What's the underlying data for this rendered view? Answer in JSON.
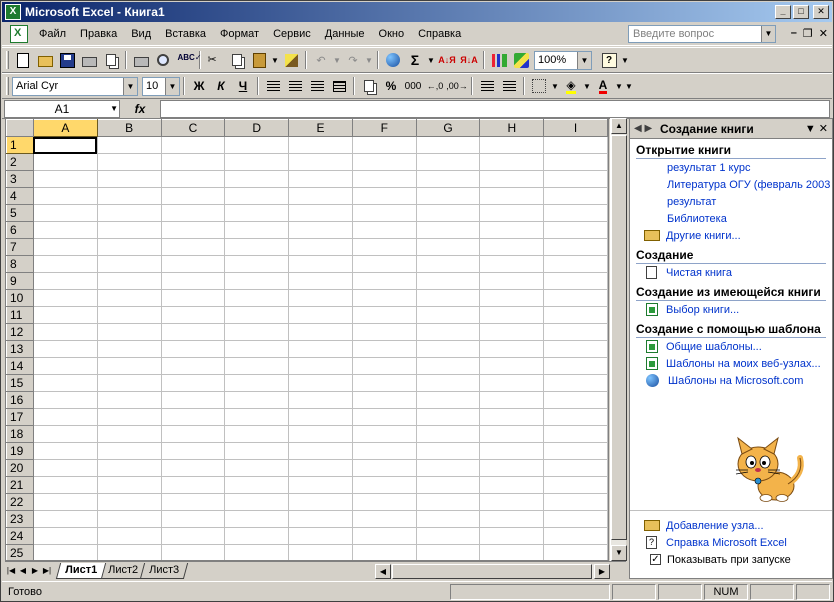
{
  "window": {
    "title": "Microsoft Excel - Книга1",
    "app_icon": "excel-icon"
  },
  "menu": {
    "items": [
      "Файл",
      "Правка",
      "Вид",
      "Вставка",
      "Формат",
      "Сервис",
      "Данные",
      "Окно",
      "Справка"
    ],
    "help_placeholder": "Введите вопрос"
  },
  "standard_toolbar": {
    "zoom": "100%"
  },
  "format_toolbar": {
    "font": "Arial Cyr",
    "size": "10",
    "bold": "Ж",
    "italic": "К",
    "underline": "Ч",
    "percent": "%",
    "thousands": "000"
  },
  "formula_bar": {
    "name_box": "A1",
    "fx": "fx",
    "value": ""
  },
  "grid": {
    "columns": [
      "A",
      "B",
      "C",
      "D",
      "E",
      "F",
      "G",
      "H",
      "I"
    ],
    "rows": [
      "1",
      "2",
      "3",
      "4",
      "5",
      "6",
      "7",
      "8",
      "9",
      "10",
      "11",
      "12",
      "13",
      "14",
      "15",
      "16",
      "17",
      "18",
      "19",
      "20",
      "21",
      "22",
      "23",
      "24",
      "25"
    ],
    "active_cell": "A1"
  },
  "sheet_tabs": [
    "Лист1",
    "Лист2",
    "Лист3"
  ],
  "task_pane": {
    "title": "Создание книги",
    "sections": {
      "open": {
        "title": "Открытие книги",
        "recent": [
          "результат 1 курс",
          "Литература ОГУ (февраль 2003",
          "результат",
          "Библиотека"
        ],
        "more": "Другие книги..."
      },
      "create": {
        "title": "Создание",
        "blank": "Чистая книга"
      },
      "from_existing": {
        "title": "Создание из имеющейся книги",
        "choose": "Выбор книги..."
      },
      "from_template": {
        "title": "Создание с помощью шаблона",
        "general": "Общие шаблоны...",
        "web": "Шаблоны на моих веб-узлах...",
        "ms": "Шаблоны на Microsoft.com"
      }
    },
    "bottom": {
      "add_node": "Добавление узла...",
      "help": "Справка Microsoft Excel",
      "show_on_start": "Показывать при запуске",
      "show_on_start_checked": true
    }
  },
  "status": {
    "text": "Готово",
    "num": "NUM"
  }
}
